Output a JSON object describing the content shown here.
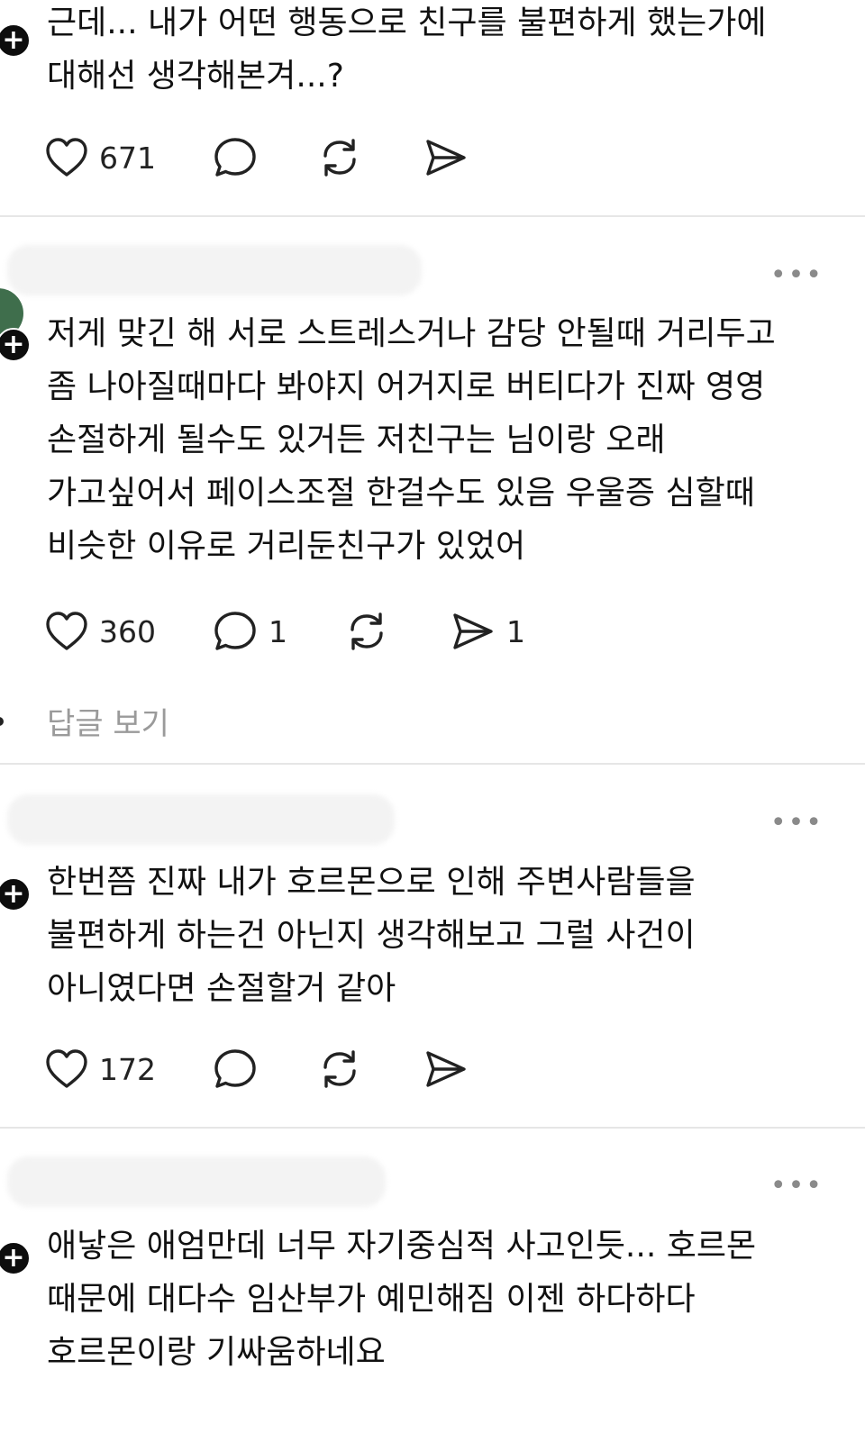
{
  "comments": [
    {
      "text": "근데... 내가 어떤 행동으로 친구를 불편하게 했는가에\n대해선 생각해본겨...?",
      "likes": "671",
      "replies": "",
      "shares": ""
    },
    {
      "text": "저게 맞긴 해 서로 스트레스거나 감당 안될때 거리두고\n좀 나아질때마다 봐야지 어거지로 버티다가 진짜 영영\n손절하게 될수도 있거든 저친구는 님이랑 오래\n가고싶어서 페이스조절 한걸수도 있음 우울증 심할때\n비슷한 이유로 거리둔친구가 있었어",
      "likes": "360",
      "replies": "1",
      "shares": "1",
      "view_replies": "답글 보기"
    },
    {
      "text": "한번쯤 진짜 내가 호르몬으로 인해 주변사람들을\n불편하게 하는건 아닌지 생각해보고 그럴 사건이\n아니였다면 손절할거 같아",
      "likes": "172",
      "replies": "",
      "shares": ""
    },
    {
      "text": "애낳은 애엄만데 너무 자기중심적 사고인듯... 호르몬\n때문에 대다수 임산부가 예민해짐 이젠 하다하다\n호르몬이랑 기싸움하네요"
    }
  ],
  "icons": {
    "like": "heart-icon",
    "reply": "comment-bubble-icon",
    "repost": "repost-icon",
    "share": "send-icon",
    "more": "more-options-icon",
    "follow": "plus-icon"
  },
  "more_label": "•••",
  "plus_label": "+"
}
